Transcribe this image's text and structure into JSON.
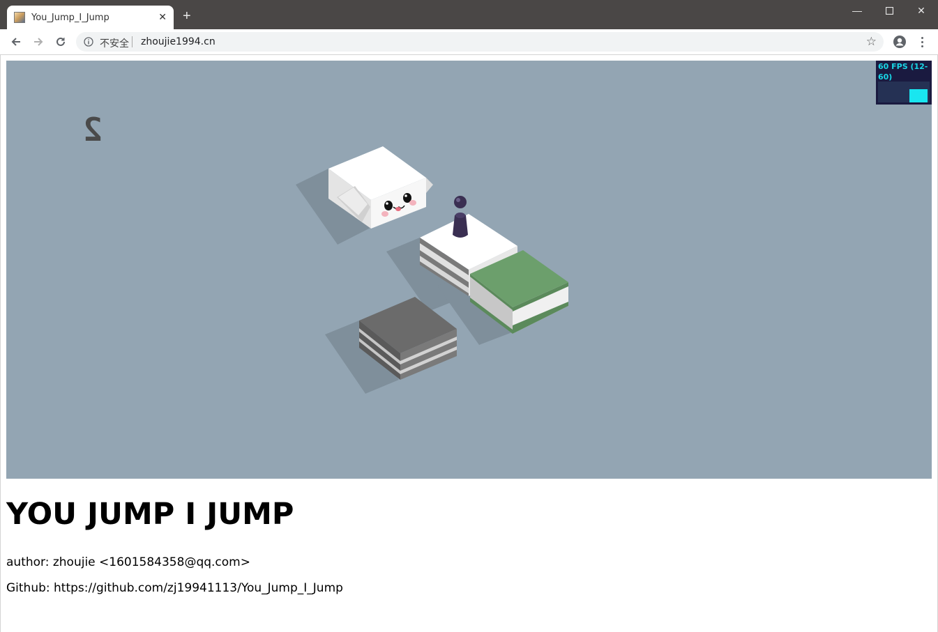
{
  "browser": {
    "tab_title": "You_Jump_I_Jump",
    "security_label": "不安全",
    "url": "zhoujie1994.cn"
  },
  "game": {
    "score": "2",
    "stats": "60 FPS (12-60)"
  },
  "page": {
    "heading": "YOU JUMP I JUMP",
    "author_line": "author: zhoujie <1601584358@qq.com>",
    "github_line": "Github: https://github.com/zj19941113/You_Jump_I_Jump"
  },
  "colors": {
    "canvas_bg": "#93a5b3",
    "block_green": "#6c9f6c",
    "block_gray": "#6b6b6b",
    "player": "#3a2f52",
    "stats_text": "#19d6e6"
  }
}
